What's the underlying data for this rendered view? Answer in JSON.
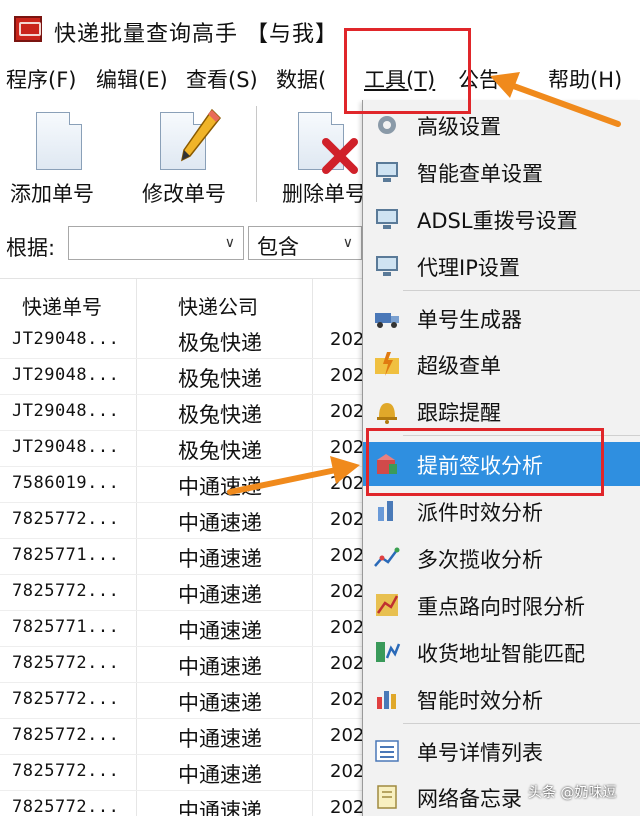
{
  "window": {
    "title": "快递批量查询高手 【与我】"
  },
  "menubar": [
    {
      "label": "程序(F)"
    },
    {
      "label": "编辑(E)"
    },
    {
      "label": "查看(S)"
    },
    {
      "label": "数据("
    },
    {
      "label": "工具(T)"
    },
    {
      "label": "公告"
    },
    {
      "label": "帮助(H)"
    }
  ],
  "toolbar": {
    "add_label": "添加单号",
    "edit_label": "修改单号",
    "delete_label": "删除单号"
  },
  "filter": {
    "label": "根据:",
    "field_value": "",
    "match_value": "包含"
  },
  "table": {
    "headers": [
      "快递单号",
      "快递公司"
    ],
    "rows": [
      {
        "no": "JT29048...",
        "company": "极兔快递",
        "date": "202"
      },
      {
        "no": "JT29048...",
        "company": "极兔快递",
        "date": "202"
      },
      {
        "no": "JT29048...",
        "company": "极兔快递",
        "date": "202"
      },
      {
        "no": "JT29048...",
        "company": "极兔快递",
        "date": "202"
      },
      {
        "no": "7586019...",
        "company": "中通速递",
        "date": "202"
      },
      {
        "no": "7825772...",
        "company": "中通速递",
        "date": "202"
      },
      {
        "no": "7825771...",
        "company": "中通速递",
        "date": "202"
      },
      {
        "no": "7825772...",
        "company": "中通速递",
        "date": "202"
      },
      {
        "no": "7825771...",
        "company": "中通速递",
        "date": "202"
      },
      {
        "no": "7825772...",
        "company": "中通速递",
        "date": "202"
      },
      {
        "no": "7825772...",
        "company": "中通速递",
        "date": "202"
      },
      {
        "no": "7825772...",
        "company": "中通速递",
        "date": "202"
      },
      {
        "no": "7825772...",
        "company": "中通速递",
        "date": "202"
      },
      {
        "no": "7825772...",
        "company": "中通速递",
        "date": "202"
      }
    ]
  },
  "tools_menu": [
    {
      "label": "高级设置",
      "icon": "gear-icon"
    },
    {
      "label": "智能查单设置",
      "icon": "monitor-settings-icon"
    },
    {
      "label": "ADSL重拨号设置",
      "icon": "network-monitor-icon"
    },
    {
      "label": "代理IP设置",
      "icon": "proxy-monitor-icon"
    },
    {
      "label": "单号生成器",
      "icon": "truck-icon"
    },
    {
      "label": "超级查单",
      "icon": "folder-lightning-icon"
    },
    {
      "label": "跟踪提醒",
      "icon": "bell-icon"
    },
    {
      "label": "提前签收分析",
      "icon": "package-analysis-icon",
      "highlighted": true
    },
    {
      "label": "派件时效分析",
      "icon": "bar-chart-icon"
    },
    {
      "label": "多次揽收分析",
      "icon": "line-chart-icon"
    },
    {
      "label": "重点路向时限分析",
      "icon": "map-route-icon"
    },
    {
      "label": "收货地址智能匹配",
      "icon": "address-match-icon"
    },
    {
      "label": "智能时效分析",
      "icon": "column-chart-icon"
    },
    {
      "label": "单号详情列表",
      "icon": "list-icon"
    },
    {
      "label": "网络备忘录",
      "icon": "memo-icon"
    }
  ],
  "watermark": "头条 @奶味逗",
  "colors": {
    "annotation_red": "#e0262a",
    "annotation_orange": "#f08a1c",
    "highlight_blue": "#2f8fe0"
  }
}
